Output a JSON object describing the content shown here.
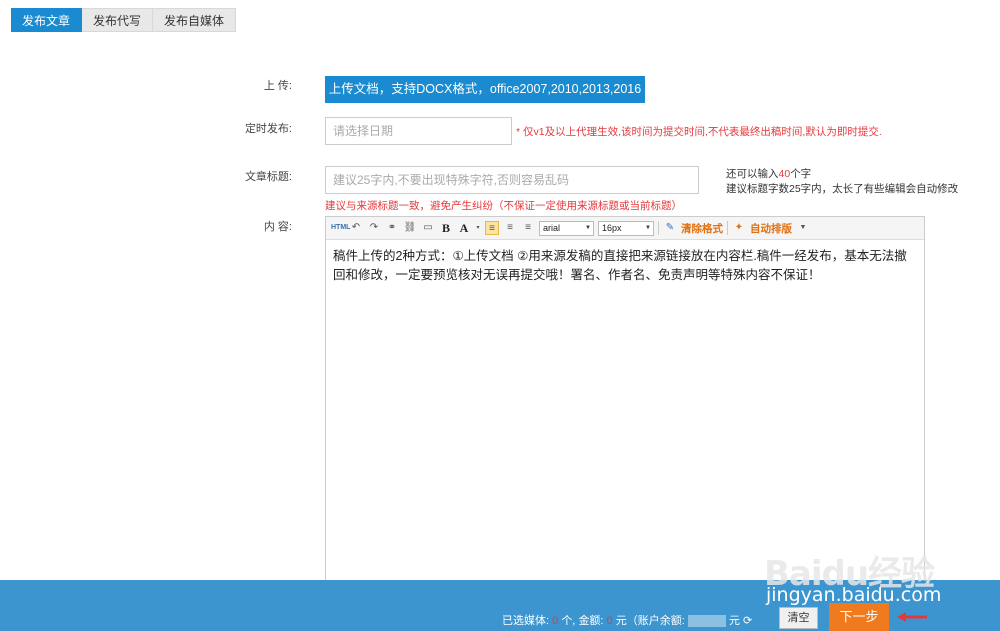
{
  "tabs": [
    {
      "label": "发布文章"
    },
    {
      "label": "发布代写"
    },
    {
      "label": "发布自媒体"
    }
  ],
  "form": {
    "upload_label": "上 传:",
    "upload_button": "上传文档，支持DOCX格式，office2007,2010,2013,2016",
    "schedule_label": "定时发布:",
    "schedule_placeholder": "请选择日期",
    "schedule_note": "* 仅v1及以上代理生效,该时间为提交时间,不代表最终出稿时间,默认为即时提交.",
    "title_label": "文章标题:",
    "title_placeholder": "建议25字内,不要出现特殊字符,否则容易乱码",
    "title_remaining_prefix": "还可以输入",
    "title_remaining_count": "40",
    "title_remaining_suffix": "个字",
    "title_advice": "建议标题字数25字内，太长了有些编辑会自动修改",
    "title_warning": "建议与来源标题一致，避免产生纠纷（不保证一定使用来源标题或当前标题）",
    "content_label": "内 容:"
  },
  "editor": {
    "toolbar": {
      "html_icon": "HTML",
      "font_family": "arial",
      "font_size": "16px",
      "clear_format": "清除格式",
      "auto_layout": "自动排版"
    },
    "content": "稿件上传的2种方式：①上传文档 ②用来源发稿的直接把来源链接放在内容栏.稿件一经发布，基本无法撤回和修改，一定要预览核对无误再提交哦！署名、作者名、免责声明等特殊内容不保证！"
  },
  "footer": {
    "selected_label": "已选媒体:",
    "selected_count": "0",
    "count_unit": "个,",
    "amount_label": "金额:",
    "amount_value": "0",
    "amount_unit": "元（账户余额:",
    "balance_suffix": "元",
    "clear_button": "清空",
    "next_button": "下一步"
  },
  "watermark": {
    "logo": "Baidu经验",
    "url": "jingyan.baidu.com"
  },
  "colors": {
    "primary": "#1a8bd0",
    "footer_bg": "#3d95cf",
    "accent_orange": "#f07b1e",
    "warning_red": "#e4393c"
  }
}
